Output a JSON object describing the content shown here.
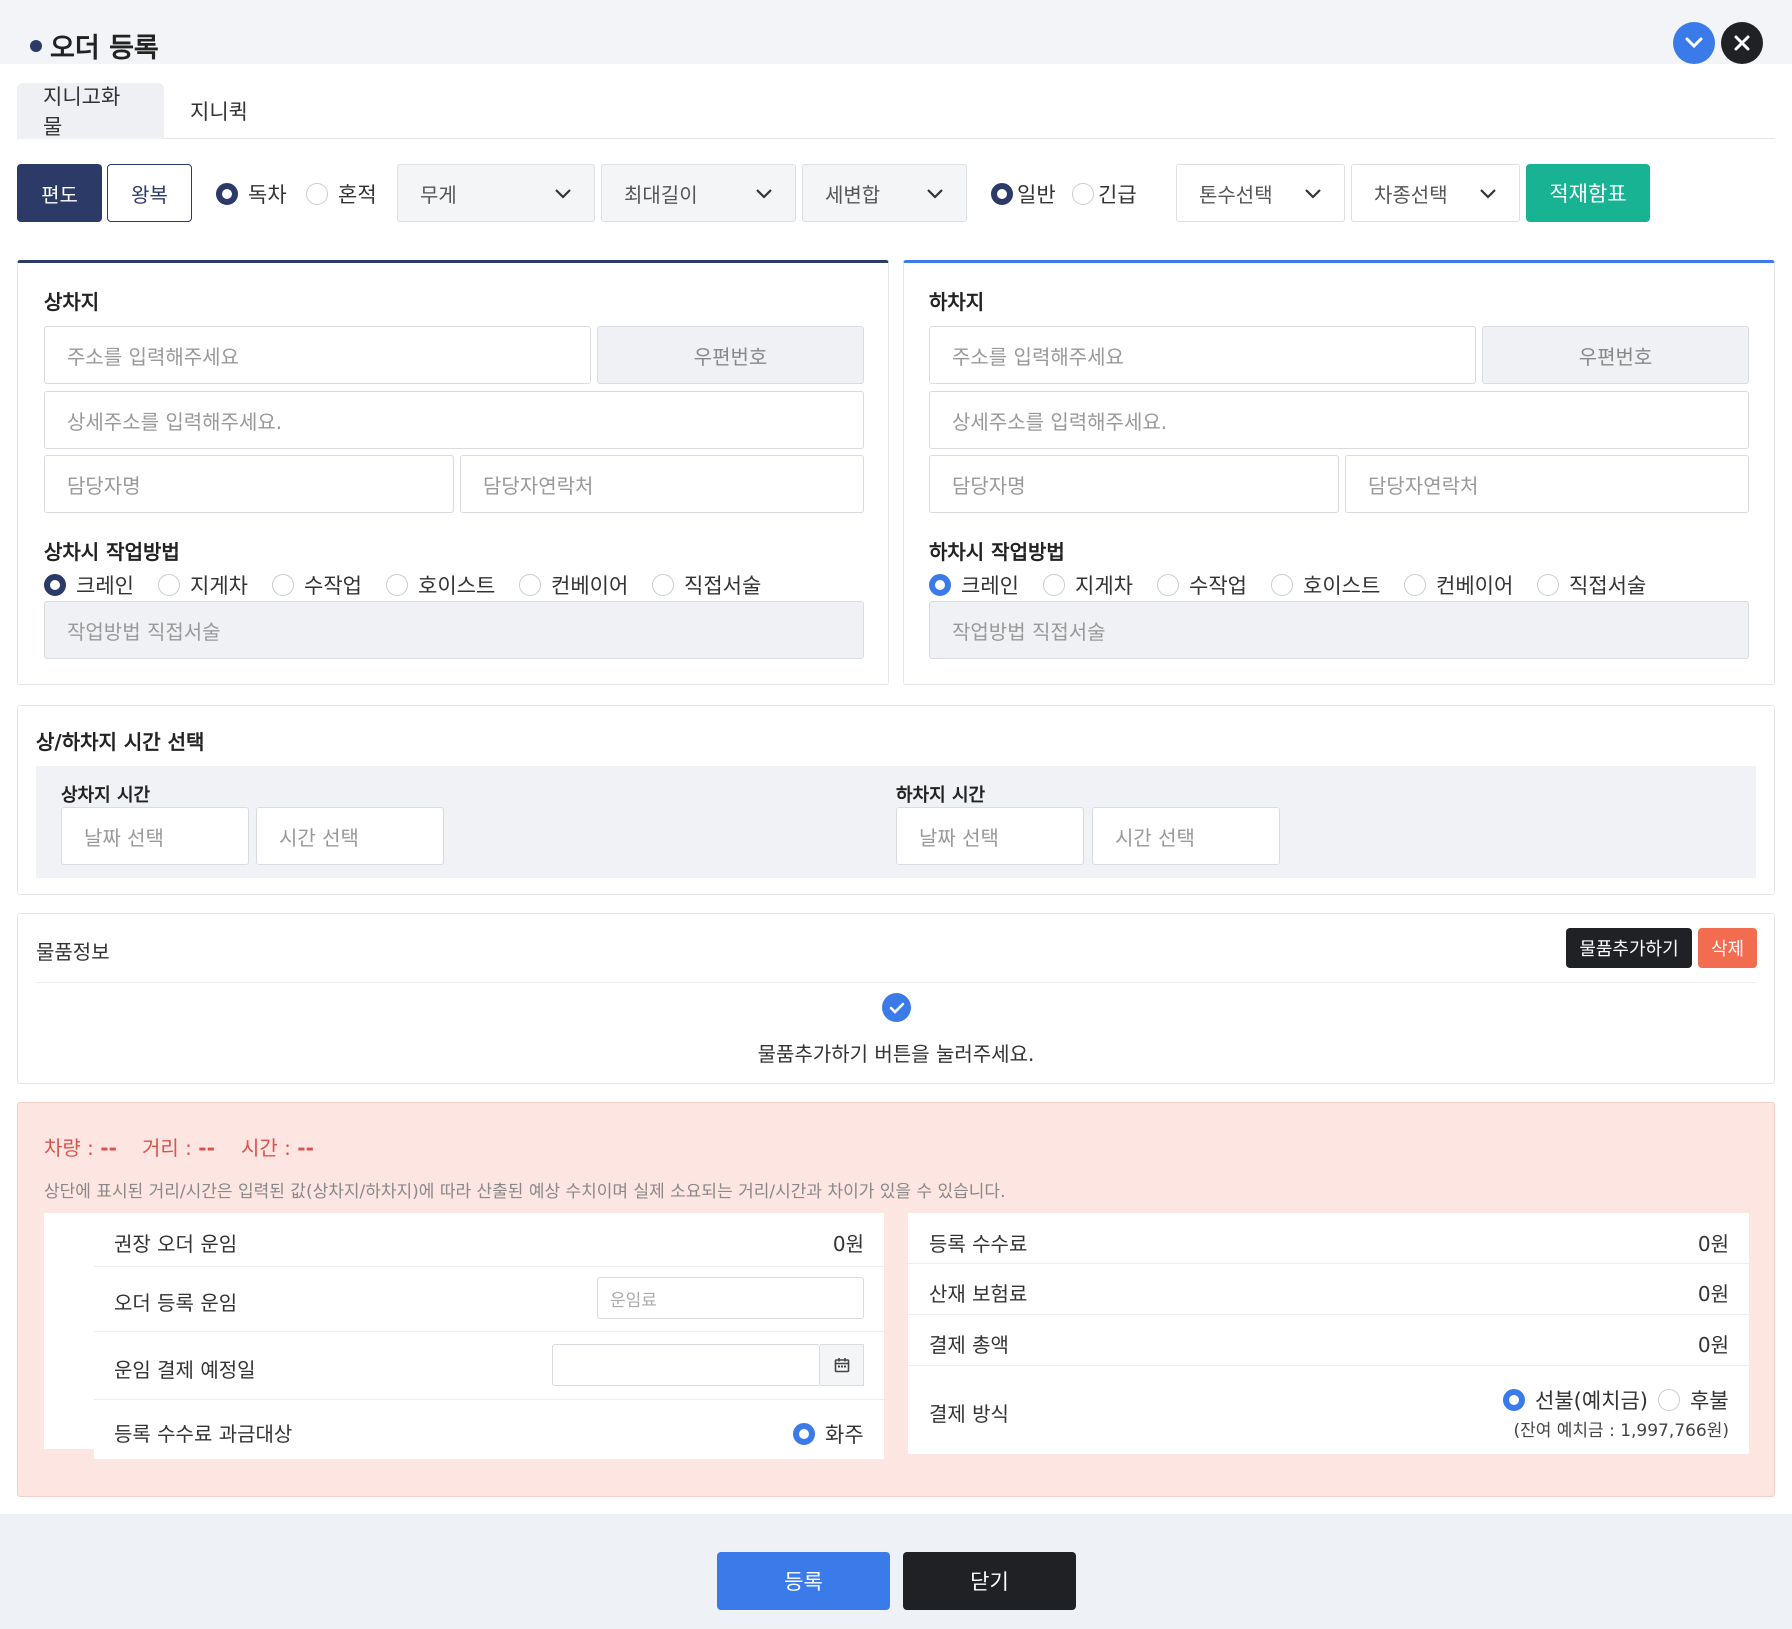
{
  "header": {
    "title": "오더 등록"
  },
  "tabs": [
    {
      "label": "지니고화물"
    },
    {
      "label": "지니퀵"
    }
  ],
  "toolbar": {
    "oneway": "편도",
    "roundtrip": "왕복",
    "exclusive": "독차",
    "mixed": "혼적",
    "weight": "무게",
    "max_length": "최대길이",
    "box_type": "세변합",
    "normal": "일반",
    "urgent": "긴급",
    "tonnage": "톤수선택",
    "vehicle_type": "차종선택",
    "load_table": "적재함표"
  },
  "pickup": {
    "title": "상차지",
    "address_placeholder": "주소를 입력해주세요",
    "postal_button": "우편번호",
    "detail_placeholder": "상세주소를 입력해주세요.",
    "contact_name_placeholder": "담당자명",
    "contact_phone_placeholder": "담당자연락처",
    "method_title": "상차시 작업방법",
    "methods": [
      "크레인",
      "지게차",
      "수작업",
      "호이스트",
      "컨베이어",
      "직접서술"
    ],
    "method_desc_placeholder": "작업방법 직접서술"
  },
  "dropoff": {
    "title": "하차지",
    "address_placeholder": "주소를 입력해주세요",
    "postal_button": "우편번호",
    "detail_placeholder": "상세주소를 입력해주세요.",
    "contact_name_placeholder": "담당자명",
    "contact_phone_placeholder": "담당자연락처",
    "method_title": "하차시 작업방법",
    "methods": [
      "크레인",
      "지게차",
      "수작업",
      "호이스트",
      "컨베이어",
      "직접서술"
    ],
    "method_desc_placeholder": "작업방법 직접서술"
  },
  "time": {
    "title": "상/하차지 시간 선택",
    "pickup_label": "상차지 시간",
    "dropoff_label": "하차지 시간",
    "date_placeholder": "날짜 선택",
    "time_placeholder": "시간 선택"
  },
  "goods": {
    "title": "물품정보",
    "add_button": "물품추가하기",
    "delete_button": "삭제",
    "empty_message": "물품추가하기 버튼을 눌러주세요."
  },
  "summary": {
    "vehicle_label": "차량 :",
    "vehicle_value": "--",
    "distance_label": "거리 :",
    "distance_value": "--",
    "time_label": "시간 :",
    "time_value": "--",
    "notice": "상단에 표시된 거리/시간은 입력된 값(상차지/하차지)에 따라 산출된 예상 수치이며 실제 소요되는 거리/시간과 차이가 있을 수 있습니다.",
    "left": {
      "recommended_label": "권장 오더 운임",
      "recommended_value": "0원",
      "order_fee_label": "오더 등록 운임",
      "order_fee_placeholder": "운임료",
      "pay_date_label": "운임 결제 예정일",
      "charge_target_label": "등록 수수료 과금대상",
      "charge_target_option": "화주"
    },
    "right": {
      "reg_fee_label": "등록 수수료",
      "reg_fee_value": "0원",
      "insurance_label": "산재 보험료",
      "insurance_value": "0원",
      "total_label": "결제 총액",
      "total_value": "0원",
      "method_label": "결제 방식",
      "prepaid": "선불(예치금)",
      "postpaid": "후불",
      "balance": "(잔여 예치금 : 1,997,766원)"
    }
  },
  "footer": {
    "submit": "등록",
    "close": "닫기"
  },
  "colors": {
    "navy": "#2b3a67",
    "blue": "#3a7be9",
    "teal": "#17b393",
    "orange": "#f26c4f",
    "dark": "#1f2124"
  }
}
